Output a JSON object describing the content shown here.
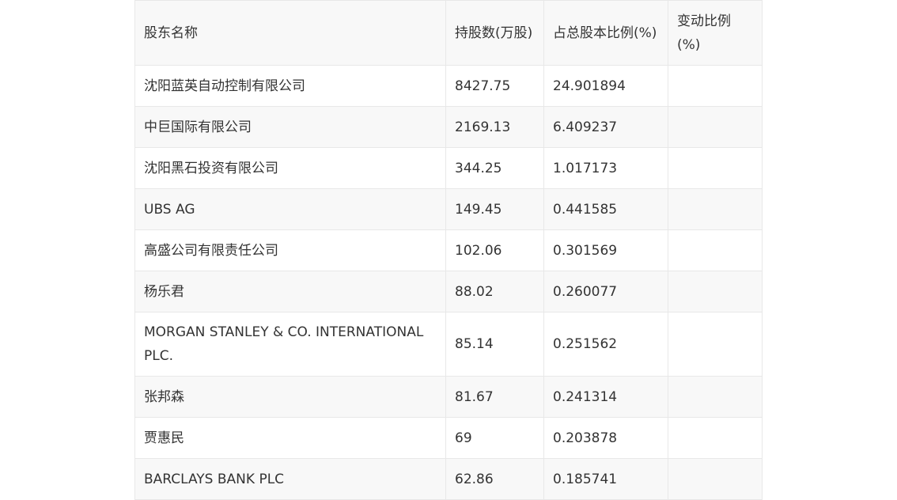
{
  "table": {
    "headers": [
      "股东名称",
      "持股数(万股)",
      "占总股本比例(%)",
      "变动比例(%)"
    ],
    "rows": [
      [
        "沈阳蓝英自动控制有限公司",
        "8427.75",
        "24.901894",
        ""
      ],
      [
        "中巨国际有限公司",
        "2169.13",
        "6.409237",
        ""
      ],
      [
        "沈阳黑石投资有限公司",
        "344.25",
        "1.017173",
        ""
      ],
      [
        "UBS AG",
        "149.45",
        "0.441585",
        ""
      ],
      [
        "高盛公司有限责任公司",
        "102.06",
        "0.301569",
        ""
      ],
      [
        "杨乐君",
        "88.02",
        "0.260077",
        ""
      ],
      [
        "MORGAN STANLEY & CO. INTERNATIONAL PLC.",
        "85.14",
        "0.251562",
        ""
      ],
      [
        "张邦森",
        "81.67",
        "0.241314",
        ""
      ],
      [
        "贾惠民",
        "69",
        "0.203878",
        ""
      ],
      [
        "BARCLAYS BANK PLC",
        "62.86",
        "0.185741",
        ""
      ]
    ]
  }
}
